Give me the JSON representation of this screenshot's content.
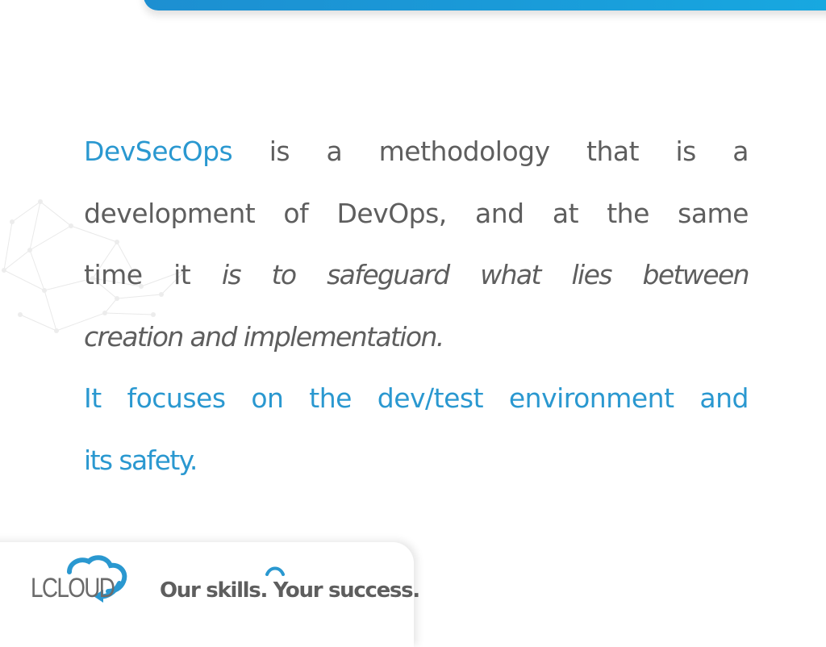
{
  "slide": {
    "paragraph1": {
      "line1": {
        "term": "DevSecOps",
        "words": [
          "is",
          "a",
          "methodology",
          "that",
          "is",
          "a"
        ]
      },
      "line2": {
        "words": [
          "development",
          "of",
          "DevOps,",
          "and",
          "at",
          "the",
          "same"
        ]
      },
      "line3": {
        "normal_words": [
          "time",
          "it"
        ],
        "italic_words": [
          "is",
          "to",
          "safeguard",
          "what",
          "lies",
          "between"
        ]
      },
      "line4": {
        "italic_text": "creation and implementation."
      }
    },
    "paragraph2": {
      "line1": {
        "words": [
          "It",
          "focuses",
          "on",
          "the",
          "dev/test",
          "environment",
          "and"
        ]
      },
      "line2": {
        "text": "its safety."
      }
    }
  },
  "footer": {
    "logo_text": "LCLOUD",
    "logo_icon": "cloud-refresh-icon",
    "tagline": "Our skills. Your success."
  },
  "colors": {
    "accent": "#2a98d0",
    "text": "#5e5e5e",
    "top_bar_start": "#1d8fd1",
    "top_bar_end": "#17a9e1"
  }
}
